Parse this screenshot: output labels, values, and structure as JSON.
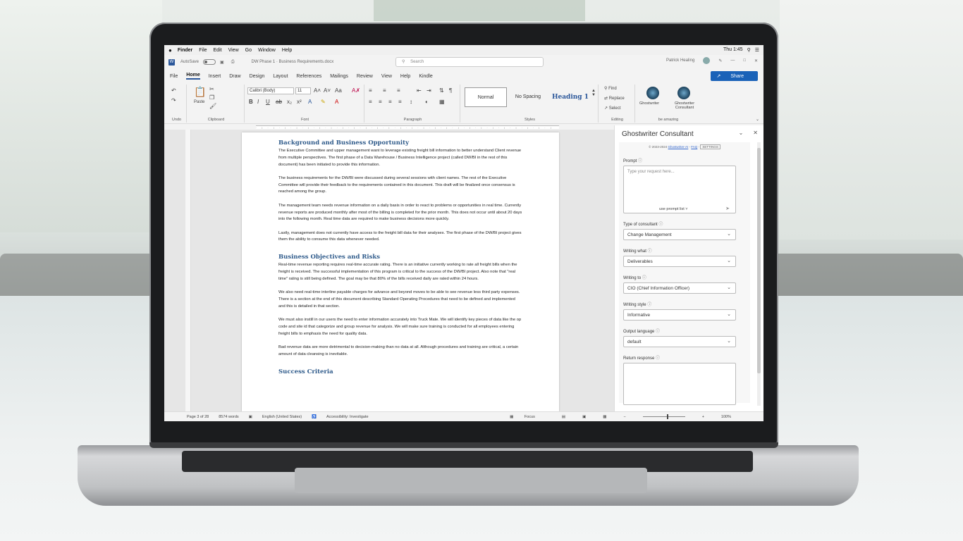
{
  "menubar": {
    "apple": "",
    "items": [
      "Finder",
      "File",
      "Edit",
      "View",
      "Go",
      "Window",
      "Help"
    ],
    "clock": "Thu 1:45"
  },
  "titlebar": {
    "autosave": "AutoSave",
    "toggle_state": "Off",
    "doc_title": "DW Phase 1 · Business Requirements.docx",
    "search_placeholder": "Search",
    "user": "Patrick Healing"
  },
  "ribbon_tabs": [
    "File",
    "Home",
    "Insert",
    "Draw",
    "Design",
    "Layout",
    "References",
    "Mailings",
    "Review",
    "View",
    "Help",
    "Kindle"
  ],
  "share_label": "Share",
  "ribbon": {
    "undo_label": "Undo",
    "clipboard_label": "Clipboard",
    "paste_label": "Paste",
    "font_name": "Calibri (Body)",
    "font_size": "11",
    "font_label": "Font",
    "paragraph_label": "Paragraph",
    "styles": [
      "Normal",
      "No Spacing",
      "Heading 1"
    ],
    "styles_label": "Styles",
    "find": "Find",
    "replace": "Replace",
    "select": "Select",
    "editing_label": "Editing",
    "gw1": "Ghostwriter",
    "gw2": "Ghostwriter Consultant",
    "gw_group": "be amazing"
  },
  "document": {
    "h_background": "Background and Business Opportunity",
    "p1": "The Executive Committee and upper management want to leverage existing freight bill information to better understand Client revenue from multiple perspectives.  The first phase of a Data Warehouse / Business Intelligence project (called DW/BI in the rest of this document) has been initiated to provide this information.",
    "p2": "The business requirements for the DW/BI were discussed during several sessions with client names.  The rest of the Executive Committee will provide their feedback to the requirements contained in this document.  This draft will be finalized once consensus is reached among the group.",
    "p3": "The management team needs revenue information on a daily basis in order to react to problems or opportunities in real time.  Currently revenue reports are produced monthly after most of the billing is completed for the prior month.  This does not occur until about 20 days into the following month.  Real time data are required to make business decisions more quickly.",
    "p4": "Lastly, management does not currently have access to the freight bill data for their analyses.  The first phase of the DW/BI project gives them the ability to consume this data whenever needed.",
    "h_objectives": "Business Objectives and Risks",
    "p5": "Real-time revenue reporting requires real-time accurate rating.  There is an initiative currently working to rate all freight bills when the freight is received.  The successful implementation of this program is critical to the success of the DW/BI project.  Also note that \"real time\" rating is still being defined.  The goal may be that 80% of the bills received daily are rated within 24 hours.",
    "p6": "We also need real-time interline payable charges for advance and beyond moves to be able to see revenue less third party expenses.  There is a section at the end of this document describing Standard Operating Procedures that need to be defined and implemented and this is detailed in that section.",
    "p7": "We must also instill in our users the need to enter information accurately into Truck Mate.  We will identify key pieces of data like the op code and site id that categorize and group revenue for analysis.  We will make sure training is conducted for all employees entering freight bills to emphasis the need for quality data.",
    "p8": "Bad revenue data are more detrimental to decision-making than no data at all.  Although procedures and training are critical, a certain amount of data cleansing is inevitable.",
    "h_next": "Success Criteria"
  },
  "status": {
    "page": "Page 3 of 28",
    "words": "8574 words",
    "language": "English (United States)",
    "accessibility": "Accessibility: Investigate",
    "focus": "Focus",
    "zoom": "100%"
  },
  "panel": {
    "title": "Ghostwriter Consultant",
    "copyright_prefix": "© 2023-2024",
    "copyright_link": "Ghostwriter-AI",
    "faq": "FAQ",
    "settings": "SETTINGS",
    "prompt_label": "Prompt",
    "prompt_placeholder": "Type your request here...",
    "prompt_list": "use prompt list",
    "consultant_label": "Type of consultant",
    "consultant_value": "Change Management",
    "writing_what_label": "Writing what",
    "writing_what_value": "Deliverables",
    "writing_to_label": "Writing to",
    "writing_to_value": "CIO (Chief Information Officer)",
    "writing_style_label": "Writing style",
    "writing_style_value": "Informative",
    "output_language_label": "Output language",
    "output_language_value": "default",
    "return_label": "Return response"
  }
}
